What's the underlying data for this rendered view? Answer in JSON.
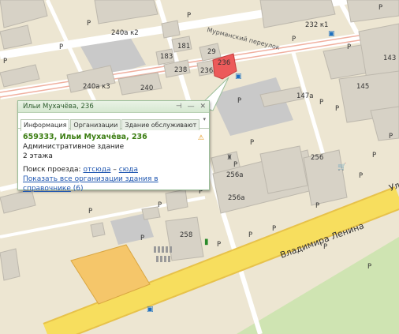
{
  "map": {
    "labels": {
      "b240k2": "240а к2",
      "b232k1": "232 к1",
      "b143": "143",
      "b181": "181",
      "b183": "183",
      "b238": "238",
      "b236a": "236а",
      "b236": "236",
      "b29": "29",
      "b240k3": "240а к3",
      "b240": "240",
      "b145": "145",
      "b147a": "147а",
      "b256": "256",
      "b256a_1": "256а",
      "b256a_2": "256а",
      "b258": "258",
      "p": "P"
    },
    "streets": {
      "lane": "Мурманский переулок",
      "lenina": "Владимира Ленина",
      "lenina_cut": "Ул"
    },
    "colors": {
      "ground": "#ede6d2",
      "building": "#d7d2c6",
      "building_dark": "#bdb8ad",
      "major_road": "#f7de5e",
      "park": "#cfe4b2",
      "marker": "#ec5a5a"
    }
  },
  "balloon": {
    "header": "Ильи Мухачёва, 236",
    "tabs": [
      "Информация",
      "Организации",
      "Здание обслуживают"
    ],
    "title": "659333, Ильи Мухачёва, 236",
    "type": "Административное здание",
    "floors": "2 этажа",
    "route_label": "Поиск проезда:",
    "route_from": "отсюда",
    "route_dash": "–",
    "route_to": "сюда",
    "show_all": "Показать все организации здания в справочнике",
    "show_all_count": "(6)"
  }
}
